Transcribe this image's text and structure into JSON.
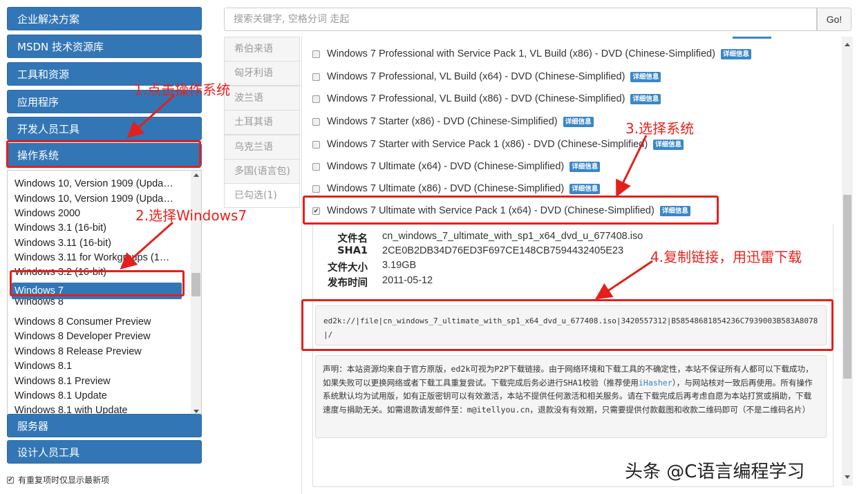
{
  "sidebar": {
    "items_top": [
      "企业解决方案",
      "MSDN 技术资源库",
      "工具和资源",
      "应用程序",
      "开发人员工具",
      "操作系统"
    ],
    "os_list": [
      "Windows 10, Version 1909 (Upda…",
      "Windows 10, Version 1909 (Upda…",
      "Windows 2000",
      "Windows 3.1 (16-bit)",
      "Windows 3.11 (16-bit)",
      "Windows 3.11 for Workgroups (1…",
      "Windows 3.2 (16-bit)",
      "Windows 7",
      "Windows 8",
      "Windows 8 Consumer Preview",
      "Windows 8 Developer Preview",
      "Windows 8 Release Preview",
      "Windows 8.1",
      "Windows 8.1 Preview",
      "Windows 8.1 Update",
      "Windows 8.1 with Update"
    ],
    "selected_os": "Windows 7",
    "items_bottom": [
      "服务器",
      "设计人员工具"
    ],
    "footer_check": "有重复项时仅显示最新项"
  },
  "search": {
    "placeholder": "搜索关键字, 空格分词 走起",
    "button": "Go!"
  },
  "languages": [
    "希伯来语",
    "匈牙利语",
    "波兰语",
    "土耳其语",
    "乌克兰语",
    "多国(语言包)",
    "已勾选(1)"
  ],
  "products": [
    {
      "name": "Windows 7 Professional with Service Pack 1, VL Build (x86) - DVD (Chinese-Simplified)",
      "checked": false
    },
    {
      "name": "Windows 7 Professional, VL Build (x64) - DVD (Chinese-Simplified)",
      "checked": false
    },
    {
      "name": "Windows 7 Professional, VL Build (x86) - DVD (Chinese-Simplified)",
      "checked": false
    },
    {
      "name": "Windows 7 Starter (x86) - DVD (Chinese-Simplified)",
      "checked": false
    },
    {
      "name": "Windows 7 Starter with Service Pack 1 (x86) - DVD (Chinese-Simplified)",
      "checked": false
    },
    {
      "name": "Windows 7 Ultimate (x64) - DVD (Chinese-Simplified)",
      "checked": false
    },
    {
      "name": "Windows 7 Ultimate (x86) - DVD (Chinese-Simplified)",
      "checked": false
    },
    {
      "name": "Windows 7 Ultimate with Service Pack 1 (x64) - DVD (Chinese-Simplified)",
      "checked": true
    }
  ],
  "badge_label": "详细信息",
  "details": {
    "filename_key": "文件名",
    "filename": "cn_windows_7_ultimate_with_sp1_x64_dvd_u_677408.iso",
    "sha1_key": "SHA1",
    "sha1": "2CE0B2DB34D76ED3F697CE148CB7594432405E23",
    "size_key": "文件大小",
    "size": "3.19GB",
    "date_key": "发布时间",
    "date": "2011-05-12",
    "ed2k": "ed2k://|file|cn_windows_7_ultimate_with_sp1_x64_dvd_u_677408.iso|3420557312|B58548681854236C7939003B583A8078|/"
  },
  "notice": {
    "part1": "声明：本站资源均来自于官方原版，ed2k可视为P2P下载链接。由于网络环境和下载工具的不确定性，本站不保证所有人都可以下载成功，如果失败可以更换网络或者下载工具重复尝试。下载完成后务必进行SHA1校验（推荐使用",
    "link": "iHasher",
    "part2": "），与网站核对一致后再使用。所有操作系统默认均为试用版，如有正版密钥可以有效激活，本站不提供任何激活和相关服务。请在下载完成后再考虑自愿为本站打赏或捐助，下载速度与捐助无关。如需退款请发邮件至：m@itellyou.cn，退款没有有效期，只需要提供付款截图和收款二维码即可（不是二维码名片）"
  },
  "annotations": {
    "step1": "1.点击操作系统",
    "step2": "2.选择Windows7",
    "step3": "3.选择系统",
    "step4": "4.复制链接，用迅雷下载"
  },
  "watermark": "头条 @C语言编程学习",
  "colors": {
    "primary_blue": "#3376b6",
    "annotation_red": "#e3201b",
    "badge_blue": "#3a86c8"
  }
}
